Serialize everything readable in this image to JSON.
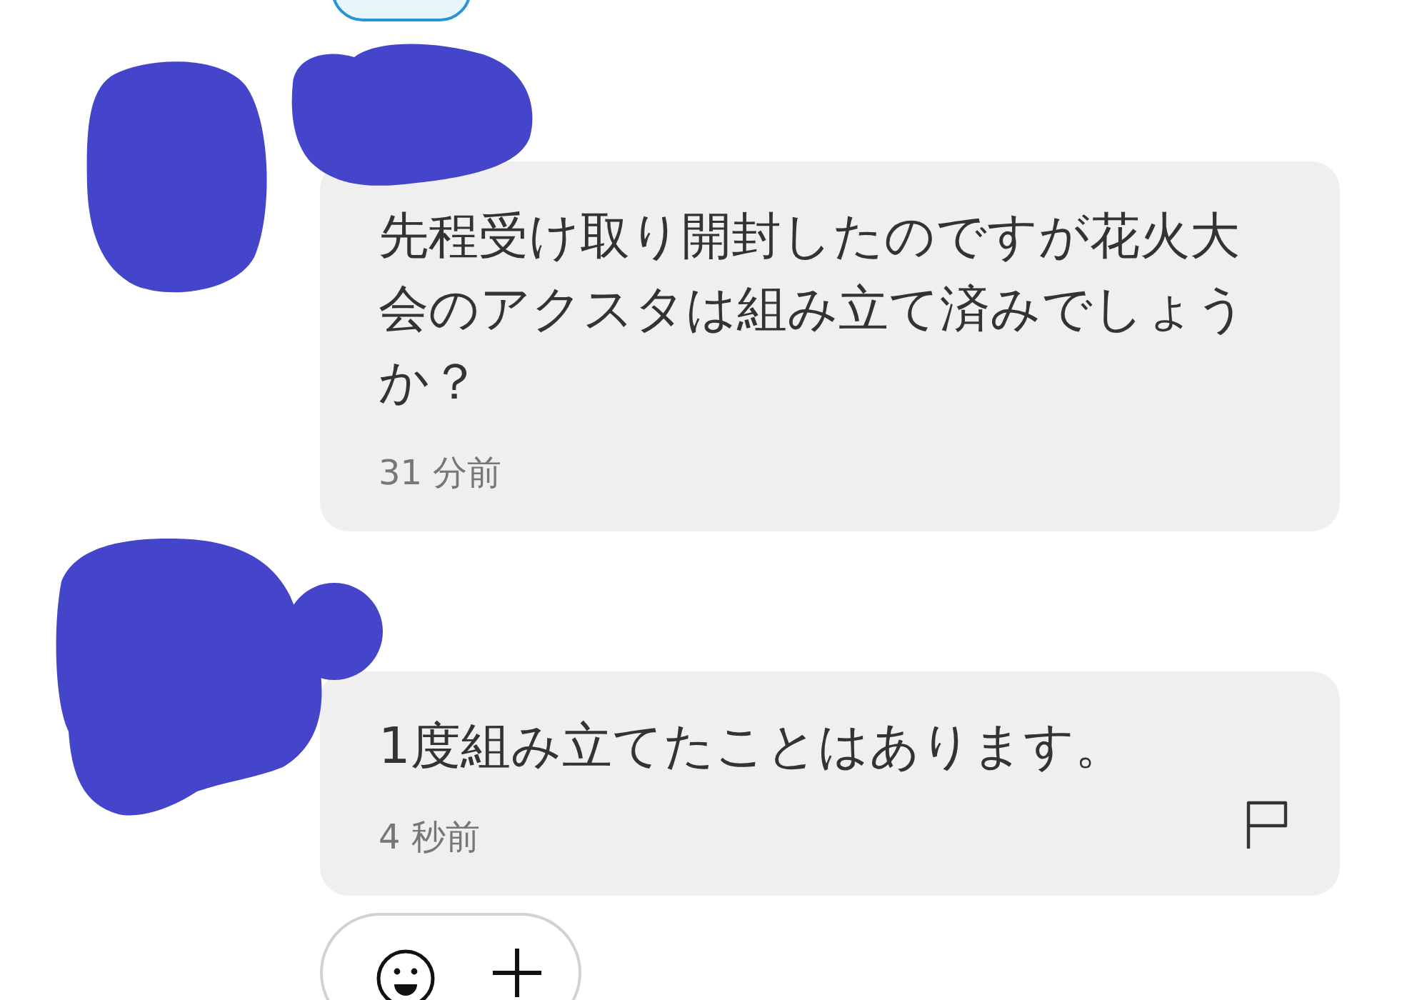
{
  "comments": [
    {
      "text": "先程受け取り開封したのですが花火大会のアクスタは組み立て済みでしょうか？",
      "time": "31 分前",
      "has_flag": false
    },
    {
      "text": "1度組み立てたことはあります。",
      "time": "4 秒前",
      "has_flag": true
    }
  ]
}
